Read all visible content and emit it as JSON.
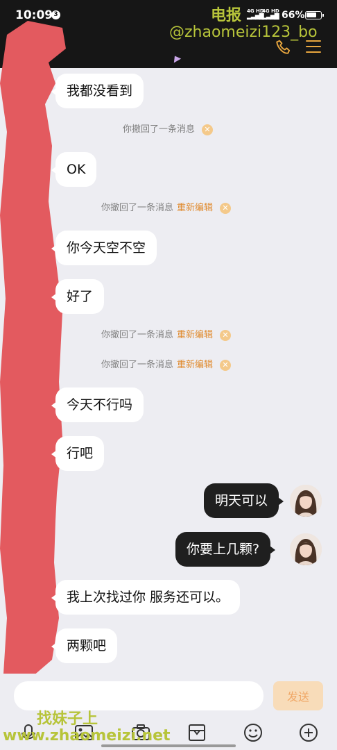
{
  "status": {
    "time": "10:09",
    "notif_count": "3",
    "signal1": "4G HD",
    "signal2": "4G HD",
    "battery": "66%"
  },
  "watermark": {
    "title": "电报",
    "handle": "@zhaomeizi123_bo",
    "bottom_title": "找妹子上",
    "bottom_url": "www.zhaomeizi.net"
  },
  "header": {
    "icons": [
      "phone-icon",
      "menu-icon"
    ]
  },
  "colors": {
    "accent": "#e08a2d",
    "outgoing_bubble": "#1f1f1f",
    "incoming_bubble": "#ffffff",
    "redaction": "#e35a5f",
    "watermark": "#b7c43a"
  },
  "messages": {
    "m1": "我都没看到",
    "sys1": "你撤回了一条消息",
    "m2": "OK",
    "sys2": "你撤回了一条消息",
    "m3": "你今天空不空",
    "m4": "好了",
    "sys3": "你撤回了一条消息",
    "sys4": "你撤回了一条消息",
    "m5": "今天不行吗",
    "m6": "行吧",
    "m7": "明天可以",
    "m8": "你要上几颗?",
    "m9": "我上次找过你 服务还可以。",
    "m10": "两颗吧",
    "reedit": "重新编辑"
  },
  "composer": {
    "placeholder": "",
    "send_label": "发送",
    "tools": [
      "voice-icon",
      "image-icon",
      "camera-icon",
      "file-box-icon",
      "emoji-icon",
      "plus-icon"
    ]
  }
}
